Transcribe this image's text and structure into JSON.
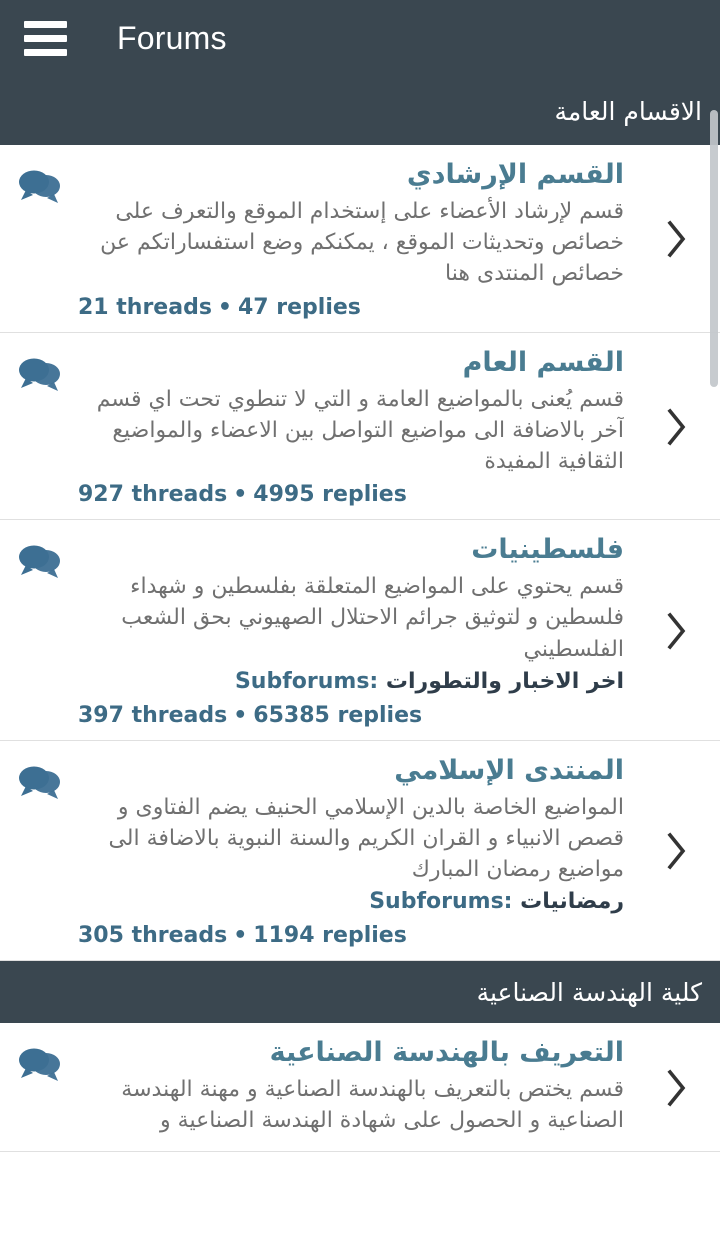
{
  "appbar": {
    "menu_icon": "hamburger-menu-icon",
    "title": "Forums"
  },
  "scrollbar": {
    "visible": true
  },
  "sections": [
    {
      "header": "الاقسام العامة",
      "forums": [
        {
          "icon": "forum-bubble-icon",
          "title": "القسم الإرشادي",
          "description": "قسم لإرشاد الأعضاء على إستخدام الموقع والتعرف على خصائص وتحديثات الموقع ، يمكنكم وضع استفساراتكم عن خصائص المنتدى هنا",
          "subforums_label": null,
          "subforums_value": null,
          "threads": "21 threads",
          "separator": "•",
          "replies": "47 replies",
          "chevron": "chevron-right-icon"
        },
        {
          "icon": "forum-bubble-icon",
          "title": "القسم العام",
          "description": "قسم يُعنى بالمواضيع العامة و التي لا تنطوي تحت اي قسم آخر بالاضافة الى مواضيع التواصل بين الاعضاء والمواضيع الثقافية المفيدة",
          "subforums_label": null,
          "subforums_value": null,
          "threads": "927 threads",
          "separator": "•",
          "replies": "4995 replies",
          "chevron": "chevron-right-icon"
        },
        {
          "icon": "forum-bubble-icon",
          "title": "فلسطينيات",
          "description": "قسم يحتوي على المواضيع المتعلقة بفلسطين و شهداء فلسطين و لتوثيق جرائم الاحتلال الصهيوني بحق الشعب الفلسطيني",
          "subforums_label": "Subforums:",
          "subforums_value": "اخر الاخبار والتطورات",
          "threads": "397 threads",
          "separator": "•",
          "replies": "65385 replies",
          "chevron": "chevron-right-icon"
        },
        {
          "icon": "forum-bubble-icon",
          "title": "المنتدى الإسلامي",
          "description": "المواضيع الخاصة بالدين الإسلامي الحنيف يضم الفتاوى و قصص الانبياء و القران الكريم والسنة النبوية بالاضافة الى مواضيع رمضان المبارك",
          "subforums_label": "Subforums:",
          "subforums_value": "رمضانيات",
          "threads": "305 threads",
          "separator": "•",
          "replies": "1194 replies",
          "chevron": "chevron-right-icon"
        }
      ]
    },
    {
      "header": "كلية الهندسة الصناعية",
      "forums": [
        {
          "icon": "forum-bubble-icon",
          "title": "التعريف بالهندسة الصناعية",
          "description": "قسم يختص بالتعريف بالهندسة الصناعية و مهنة الهندسة الصناعية  و الحصول على شهادة الهندسة الصناعية و",
          "subforums_label": null,
          "subforums_value": null,
          "threads": null,
          "separator": null,
          "replies": null,
          "chevron": "chevron-right-icon"
        }
      ]
    }
  ],
  "colors": {
    "appbar_bg": "#3a4750",
    "section_header_bg": "#3a4750",
    "title_accent": "#4a7c91",
    "stats_accent": "#3d6b85",
    "description": "#707070",
    "bubble": "#3d6f93",
    "chevron": "#333333",
    "divider": "#e0e0e0",
    "page_bg": "#ffffff"
  }
}
